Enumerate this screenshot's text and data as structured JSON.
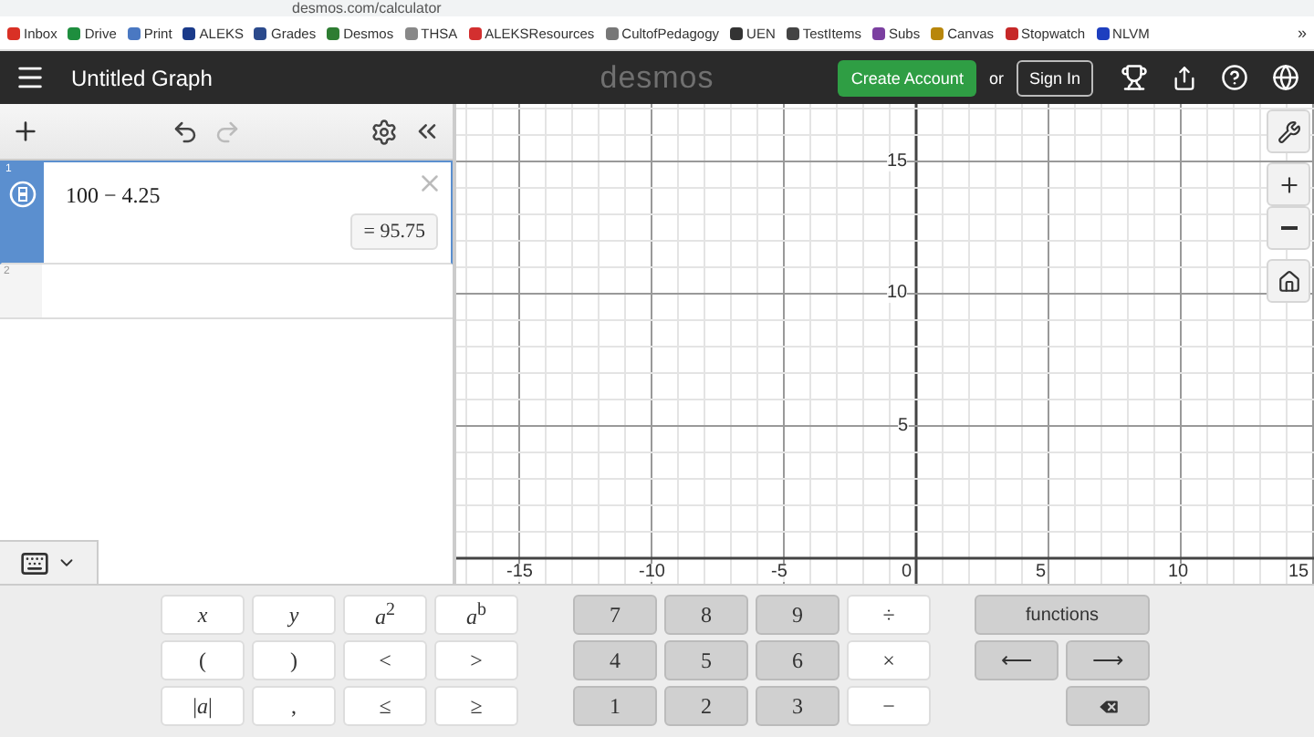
{
  "browser": {
    "url": "desmos.com/calculator",
    "bookmarks": [
      {
        "label": "Inbox",
        "color": "#d93025"
      },
      {
        "label": "Drive",
        "color": "#1e8e3e"
      },
      {
        "label": "Print",
        "color": "#4a78c2"
      },
      {
        "label": "ALEKS",
        "color": "#1a3a8a"
      },
      {
        "label": "Grades",
        "color": "#2b4a8c"
      },
      {
        "label": "Desmos",
        "color": "#2e7d32"
      },
      {
        "label": "THSA",
        "color": "#888888"
      },
      {
        "label": "ALEKSResources",
        "color": "#d32f2f"
      },
      {
        "label": "CultofPedagogy",
        "color": "#777777"
      },
      {
        "label": "UEN",
        "color": "#333333"
      },
      {
        "label": "TestItems",
        "color": "#444444"
      },
      {
        "label": "Subs",
        "color": "#7b3fa0"
      },
      {
        "label": "Canvas",
        "color": "#b8860b"
      },
      {
        "label": "Stopwatch",
        "color": "#c62828"
      },
      {
        "label": "NLVM",
        "color": "#1e3fbf"
      }
    ],
    "more": "»"
  },
  "header": {
    "title": "Untitled Graph",
    "logo": "desmos",
    "create_account": "Create Account",
    "or": "or",
    "sign_in": "Sign In"
  },
  "expressions": [
    {
      "number": "1",
      "latex": "100 − 4.25",
      "result": "= 95.75",
      "selected": true
    },
    {
      "number": "2",
      "selected": false
    }
  ],
  "graph": {
    "x_labels": [
      "-15",
      "-10",
      "-5",
      "0",
      "5",
      "10",
      "15"
    ],
    "y_labels": [
      "15",
      "10",
      "5"
    ]
  },
  "keypad": {
    "groups": [
      {
        "kind": "light",
        "keys": [
          "*x*",
          "*y*",
          "*a*$^{2}$",
          "*a*$^{b}$",
          "(",
          ")",
          "<",
          ">",
          "|*a*|",
          ",",
          "≤",
          "≥"
        ]
      },
      {
        "kind": "number",
        "keys": [
          "7",
          "8",
          "9",
          "÷",
          "4",
          "5",
          "6",
          "×",
          "1",
          "2",
          "3",
          "−"
        ]
      }
    ],
    "functions": "functions",
    "left": "⟵",
    "right": "⟶"
  }
}
